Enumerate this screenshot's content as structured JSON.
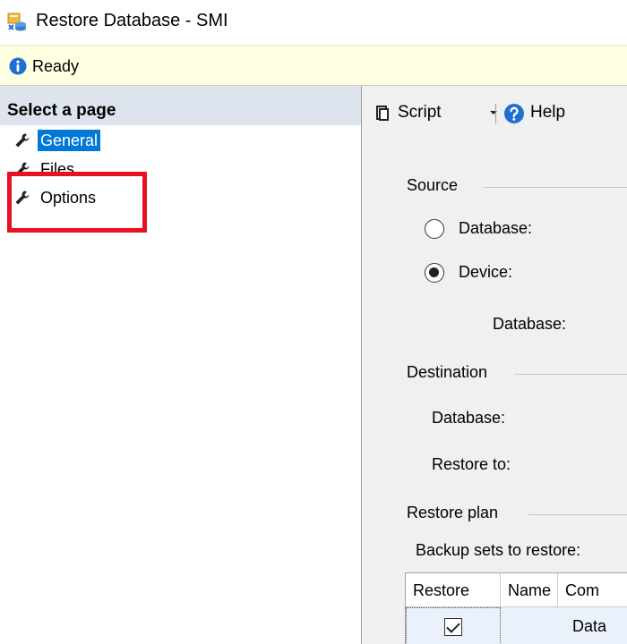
{
  "window": {
    "title": "Restore Database - SMI"
  },
  "status": {
    "text": "Ready"
  },
  "sidebar": {
    "header": "Select a page",
    "items": [
      {
        "label": "General",
        "selected": true
      },
      {
        "label": "Files",
        "selected": false
      },
      {
        "label": "Options",
        "selected": false
      }
    ]
  },
  "toolbar": {
    "script_label": "Script",
    "help_label": "Help"
  },
  "source": {
    "group_label": "Source",
    "database_option": "Database:",
    "device_option": "Device:",
    "device_database_label": "Database:",
    "selected_option": "Device"
  },
  "destination": {
    "group_label": "Destination",
    "database_label": "Database:",
    "restore_to_label": "Restore to:"
  },
  "restore_plan": {
    "group_label": "Restore plan",
    "backup_sets_label": "Backup sets to restore:",
    "columns": [
      "Restore",
      "Name",
      "Com"
    ],
    "rows": [
      {
        "restore_checked": true,
        "name": "",
        "component": "Data"
      }
    ]
  },
  "colors": {
    "selection": "#0078d7",
    "highlight_box": "#e81123",
    "status_bar": "#ffffe1",
    "sidebar_header": "#dde4ee"
  }
}
